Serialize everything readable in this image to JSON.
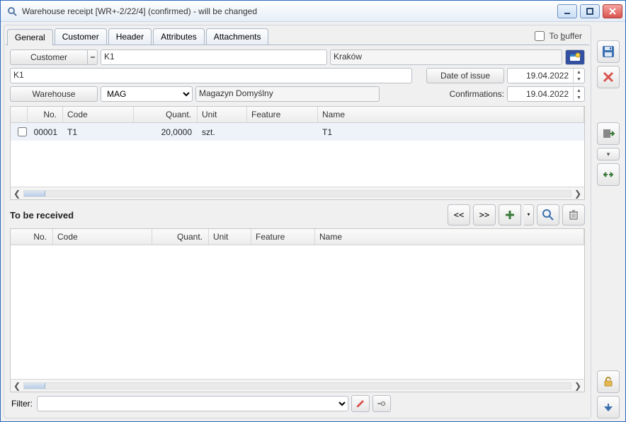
{
  "window": {
    "title": "Warehouse receipt [WR+-2/22/4] (confirmed) - will be changed"
  },
  "tabs": {
    "general": "General",
    "customer": "Customer",
    "header": "Header",
    "attributes": "Attributes",
    "attachments": "Attachments"
  },
  "buffer_label": "To buffer",
  "form": {
    "customer_btn": "Customer",
    "customer_code": "K1",
    "customer_city": "Kraków",
    "customer_fullname": "K1",
    "date_of_issue_btn": "Date of issue",
    "date_of_issue": "19.04.2022",
    "warehouse_btn": "Warehouse",
    "warehouse_code": "MAG",
    "warehouse_name": "Magazyn Domyślny",
    "confirmations_lbl": "Confirmations:",
    "confirmations_date": "19.04.2022"
  },
  "items": {
    "columns": {
      "no": "No.",
      "code": "Code",
      "quant": "Quant.",
      "unit": "Unit",
      "feature": "Feature",
      "name": "Name"
    },
    "rows": [
      {
        "no": "00001",
        "code": "T1",
        "quant": "20,0000",
        "unit": "szt.",
        "feature": "",
        "name": "T1"
      }
    ]
  },
  "to_receive_title": "To be received",
  "nav": {
    "prev": "<<",
    "next": ">>"
  },
  "to_receive": {
    "columns": {
      "no": "No.",
      "code": "Code",
      "quant": "Quant.",
      "unit": "Unit",
      "feature": "Feature",
      "name": "Name"
    }
  },
  "filter_label": "Filter:"
}
